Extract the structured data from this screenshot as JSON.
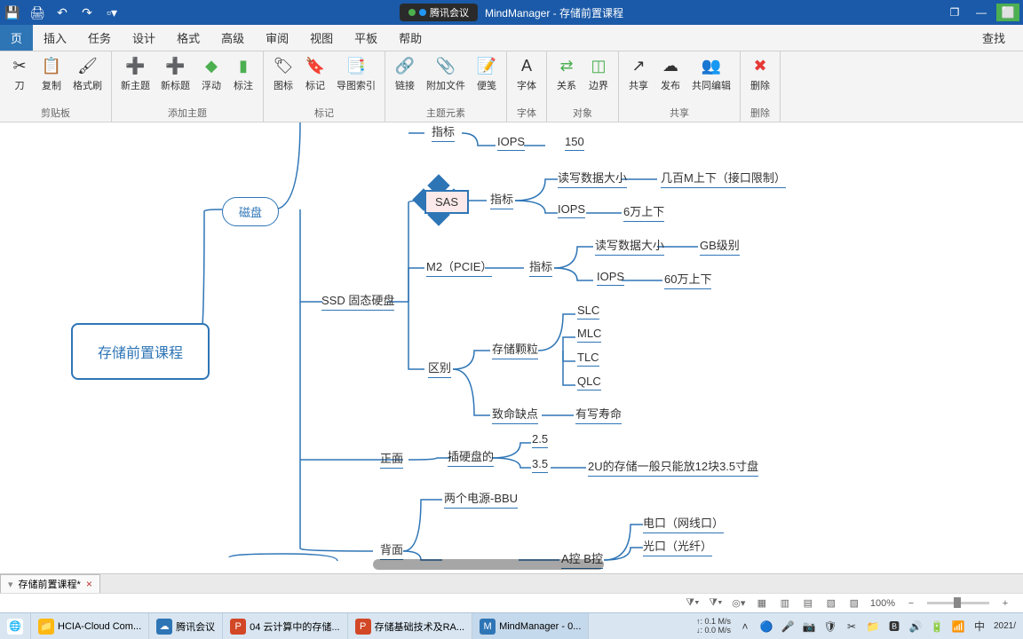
{
  "titlebar": {
    "app_name": "MindManager",
    "separator": " - ",
    "doc_name": "存储前置课程",
    "meeting_label": "腾讯会议"
  },
  "menubar": {
    "tabs": [
      "页",
      "插入",
      "任务",
      "设计",
      "格式",
      "高级",
      "审阅",
      "视图",
      "平板",
      "帮助"
    ],
    "find": "查找"
  },
  "ribbon": {
    "groups": [
      {
        "label": "剪贴板",
        "items": [
          "刀",
          "复制",
          "格式刷"
        ]
      },
      {
        "label": "添加主题",
        "items": [
          "新主题",
          "新标题",
          "浮动",
          "标注"
        ]
      },
      {
        "label": "标记",
        "items": [
          "图标",
          "标记",
          "导图索引"
        ]
      },
      {
        "label": "主题元素",
        "items": [
          "链接",
          "附加文件",
          "便笺"
        ]
      },
      {
        "label": "字体",
        "items": [
          "字体"
        ]
      },
      {
        "label": "对象",
        "items": [
          "关系",
          "边界"
        ]
      },
      {
        "label": "共享",
        "items": [
          "共享",
          "发布",
          "共同编辑"
        ]
      },
      {
        "label": "删除",
        "items": [
          "删除"
        ]
      }
    ]
  },
  "mindmap": {
    "root": "存储前置课程",
    "disk_node": "磁盘",
    "sas_selected": "SAS",
    "nodes": {
      "zhibiao1": "指标",
      "iops1": "IOPS",
      "iops1_val": "150",
      "zhibiao_sas": "指标",
      "rw_size_sas": "读写数据大小",
      "rw_size_sas_val": "几百M上下（接口限制）",
      "iops_sas": "IOPS",
      "iops_sas_val": "6万上下",
      "ssd": "SSD 固态硬盘",
      "m2": "M2（PCIE）",
      "zhibiao_m2": "指标",
      "rw_size_m2": "读写数据大小",
      "rw_size_m2_val": "GB级别",
      "iops_m2": "IOPS",
      "iops_m2_val": "60万上下",
      "qubie": "区别",
      "storage_cell": "存储颗粒",
      "slc": "SLC",
      "mlc": "MLC",
      "tlc": "TLC",
      "qlc": "QLC",
      "fatal": "致命缺点",
      "fatal_val": "有写寿命",
      "front": "正面",
      "insert_disk": "插硬盘的",
      "size25": "2.5",
      "size35": "3.5",
      "size35_note": "2U的存储一般只能放12块3.5寸盘",
      "back": "背面",
      "psu": "两个电源-BBU",
      "ctrl": "A控 B控",
      "rj45": "电口（网线口）",
      "fiber": "光口（光纤）"
    }
  },
  "doctab": {
    "name": "存储前置课程*"
  },
  "statusbar": {
    "zoom": "100%"
  },
  "taskbar": {
    "items": [
      "HCIA-Cloud Com...",
      "腾讯会议",
      "04 云计算中的存储...",
      "存储基础技术及RA...",
      "MindManager - 0..."
    ],
    "net_up": "↑: 0.1 M/s",
    "net_down": "↓: 0.0 M/s",
    "date": "2021/"
  },
  "colors": {
    "primary": "#2e75b6",
    "titlebar": "#1b5aa8"
  }
}
